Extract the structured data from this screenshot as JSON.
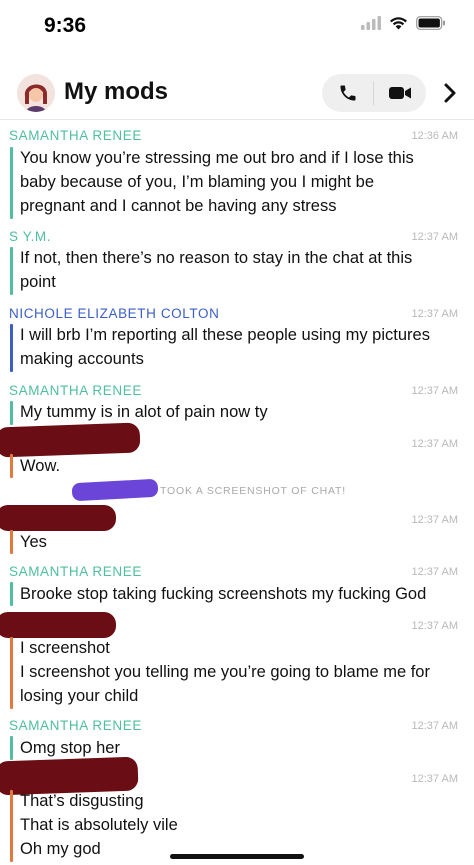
{
  "status_bar": {
    "time": "9:36"
  },
  "header": {
    "title": "My mods"
  },
  "colors": {
    "samantha": "#4fbf9f",
    "sym": "#4fbf9f",
    "nichole": "#3b5fc4",
    "me": "#e37a3c",
    "redaction": "#6b0d14",
    "scribble": "#6b45d8"
  },
  "messages": [
    {
      "sender": "SAMANTHA RENEE",
      "time": "12:36 AM",
      "lines": [
        "You know you’re stressing me out bro and if I lose this",
        "baby because of you, I’m blaming you I might be",
        "pregnant and I cannot be having any stress"
      ]
    },
    {
      "sender": "S Y.M.",
      "time": "12:37 AM",
      "lines": [
        "If not, then there’s no reason to stay in the chat at this",
        "point"
      ]
    },
    {
      "sender": "NICHOLE ELIZABETH COLTON",
      "time": "12:37 AM",
      "lines": [
        "I will brb I’m reporting all these people using my pictures",
        "making accounts"
      ]
    },
    {
      "sender": "SAMANTHA RENEE",
      "time": "12:37 AM",
      "lines": [
        "My tummy is in alot of pain now ty"
      ]
    },
    {
      "sender": "",
      "time": "12:37 AM",
      "lines": [
        "Wow."
      ]
    },
    {
      "notice": "TOOK A SCREENSHOT OF CHAT!"
    },
    {
      "sender": "",
      "time": "12:37 AM",
      "lines": [
        "Yes"
      ]
    },
    {
      "sender": "SAMANTHA RENEE",
      "time": "12:37 AM",
      "lines": [
        "Brooke stop taking fucking screenshots my fucking God"
      ]
    },
    {
      "sender": "",
      "time": "12:37 AM",
      "lines": [
        "I screenshot",
        "I screenshot you telling me you’re going to blame me for",
        "losing your child"
      ]
    },
    {
      "sender": "SAMANTHA RENEE",
      "time": "12:37 AM",
      "lines": [
        "Omg stop her"
      ]
    },
    {
      "sender": "",
      "time": "12:37 AM",
      "lines": [
        "That’s disgusting",
        "That is absolutely vile",
        "Oh my god"
      ]
    }
  ]
}
